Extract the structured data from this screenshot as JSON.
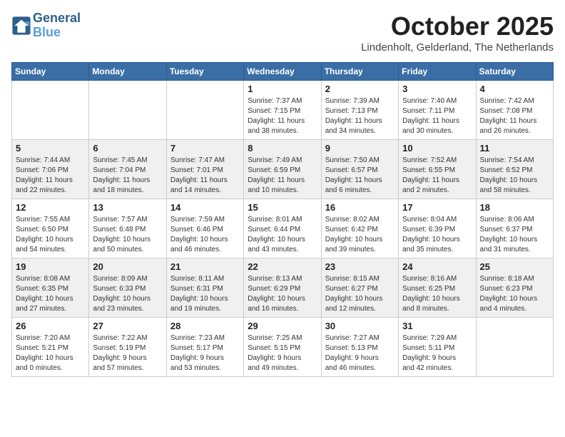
{
  "header": {
    "logo_line1": "General",
    "logo_line2": "Blue",
    "month": "October 2025",
    "location": "Lindenholt, Gelderland, The Netherlands"
  },
  "weekdays": [
    "Sunday",
    "Monday",
    "Tuesday",
    "Wednesday",
    "Thursday",
    "Friday",
    "Saturday"
  ],
  "weeks": [
    [
      {
        "day": "",
        "info": ""
      },
      {
        "day": "",
        "info": ""
      },
      {
        "day": "",
        "info": ""
      },
      {
        "day": "1",
        "info": "Sunrise: 7:37 AM\nSunset: 7:15 PM\nDaylight: 11 hours\nand 38 minutes."
      },
      {
        "day": "2",
        "info": "Sunrise: 7:39 AM\nSunset: 7:13 PM\nDaylight: 11 hours\nand 34 minutes."
      },
      {
        "day": "3",
        "info": "Sunrise: 7:40 AM\nSunset: 7:11 PM\nDaylight: 11 hours\nand 30 minutes."
      },
      {
        "day": "4",
        "info": "Sunrise: 7:42 AM\nSunset: 7:08 PM\nDaylight: 11 hours\nand 26 minutes."
      }
    ],
    [
      {
        "day": "5",
        "info": "Sunrise: 7:44 AM\nSunset: 7:06 PM\nDaylight: 11 hours\nand 22 minutes."
      },
      {
        "day": "6",
        "info": "Sunrise: 7:45 AM\nSunset: 7:04 PM\nDaylight: 11 hours\nand 18 minutes."
      },
      {
        "day": "7",
        "info": "Sunrise: 7:47 AM\nSunset: 7:01 PM\nDaylight: 11 hours\nand 14 minutes."
      },
      {
        "day": "8",
        "info": "Sunrise: 7:49 AM\nSunset: 6:59 PM\nDaylight: 11 hours\nand 10 minutes."
      },
      {
        "day": "9",
        "info": "Sunrise: 7:50 AM\nSunset: 6:57 PM\nDaylight: 11 hours\nand 6 minutes."
      },
      {
        "day": "10",
        "info": "Sunrise: 7:52 AM\nSunset: 6:55 PM\nDaylight: 11 hours\nand 2 minutes."
      },
      {
        "day": "11",
        "info": "Sunrise: 7:54 AM\nSunset: 6:52 PM\nDaylight: 10 hours\nand 58 minutes."
      }
    ],
    [
      {
        "day": "12",
        "info": "Sunrise: 7:55 AM\nSunset: 6:50 PM\nDaylight: 10 hours\nand 54 minutes."
      },
      {
        "day": "13",
        "info": "Sunrise: 7:57 AM\nSunset: 6:48 PM\nDaylight: 10 hours\nand 50 minutes."
      },
      {
        "day": "14",
        "info": "Sunrise: 7:59 AM\nSunset: 6:46 PM\nDaylight: 10 hours\nand 46 minutes."
      },
      {
        "day": "15",
        "info": "Sunrise: 8:01 AM\nSunset: 6:44 PM\nDaylight: 10 hours\nand 43 minutes."
      },
      {
        "day": "16",
        "info": "Sunrise: 8:02 AM\nSunset: 6:42 PM\nDaylight: 10 hours\nand 39 minutes."
      },
      {
        "day": "17",
        "info": "Sunrise: 8:04 AM\nSunset: 6:39 PM\nDaylight: 10 hours\nand 35 minutes."
      },
      {
        "day": "18",
        "info": "Sunrise: 8:06 AM\nSunset: 6:37 PM\nDaylight: 10 hours\nand 31 minutes."
      }
    ],
    [
      {
        "day": "19",
        "info": "Sunrise: 8:08 AM\nSunset: 6:35 PM\nDaylight: 10 hours\nand 27 minutes."
      },
      {
        "day": "20",
        "info": "Sunrise: 8:09 AM\nSunset: 6:33 PM\nDaylight: 10 hours\nand 23 minutes."
      },
      {
        "day": "21",
        "info": "Sunrise: 8:11 AM\nSunset: 6:31 PM\nDaylight: 10 hours\nand 19 minutes."
      },
      {
        "day": "22",
        "info": "Sunrise: 8:13 AM\nSunset: 6:29 PM\nDaylight: 10 hours\nand 16 minutes."
      },
      {
        "day": "23",
        "info": "Sunrise: 8:15 AM\nSunset: 6:27 PM\nDaylight: 10 hours\nand 12 minutes."
      },
      {
        "day": "24",
        "info": "Sunrise: 8:16 AM\nSunset: 6:25 PM\nDaylight: 10 hours\nand 8 minutes."
      },
      {
        "day": "25",
        "info": "Sunrise: 8:18 AM\nSunset: 6:23 PM\nDaylight: 10 hours\nand 4 minutes."
      }
    ],
    [
      {
        "day": "26",
        "info": "Sunrise: 7:20 AM\nSunset: 5:21 PM\nDaylight: 10 hours\nand 0 minutes."
      },
      {
        "day": "27",
        "info": "Sunrise: 7:22 AM\nSunset: 5:19 PM\nDaylight: 9 hours\nand 57 minutes."
      },
      {
        "day": "28",
        "info": "Sunrise: 7:23 AM\nSunset: 5:17 PM\nDaylight: 9 hours\nand 53 minutes."
      },
      {
        "day": "29",
        "info": "Sunrise: 7:25 AM\nSunset: 5:15 PM\nDaylight: 9 hours\nand 49 minutes."
      },
      {
        "day": "30",
        "info": "Sunrise: 7:27 AM\nSunset: 5:13 PM\nDaylight: 9 hours\nand 46 minutes."
      },
      {
        "day": "31",
        "info": "Sunrise: 7:29 AM\nSunset: 5:11 PM\nDaylight: 9 hours\nand 42 minutes."
      },
      {
        "day": "",
        "info": ""
      }
    ]
  ]
}
